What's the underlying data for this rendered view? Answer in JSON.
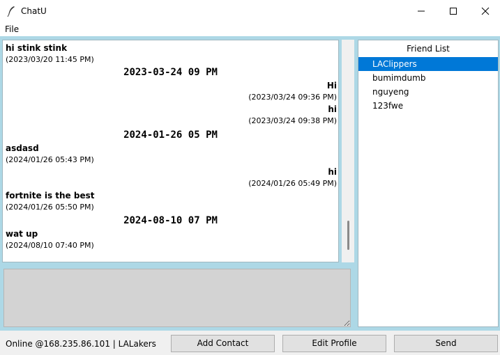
{
  "window": {
    "title": "ChatU",
    "app_icon": "feather-icon",
    "controls": [
      "minimize-icon",
      "maximize-icon",
      "close-icon"
    ]
  },
  "menu": {
    "items": [
      "File"
    ]
  },
  "chat": {
    "messages": [
      {
        "kind": "msg",
        "align": "left",
        "text": "hi stink stink"
      },
      {
        "kind": "ts",
        "align": "left",
        "text": "(2023/03/20 11:45 PM)"
      },
      {
        "kind": "date",
        "align": "center",
        "text": "2023-03-24 09 PM"
      },
      {
        "kind": "msg",
        "align": "right",
        "text": "Hi"
      },
      {
        "kind": "ts",
        "align": "right",
        "text": "(2023/03/24 09:36 PM)"
      },
      {
        "kind": "msg",
        "align": "right",
        "text": "hi"
      },
      {
        "kind": "ts",
        "align": "right",
        "text": "(2023/03/24 09:38 PM)"
      },
      {
        "kind": "date",
        "align": "center",
        "text": "2024-01-26 05 PM"
      },
      {
        "kind": "msg",
        "align": "left",
        "text": "asdasd"
      },
      {
        "kind": "ts",
        "align": "left",
        "text": "(2024/01/26 05:43 PM)"
      },
      {
        "kind": "msg",
        "align": "right",
        "text": "hi"
      },
      {
        "kind": "ts",
        "align": "right",
        "text": "(2024/01/26 05:49 PM)"
      },
      {
        "kind": "msg",
        "align": "left",
        "text": "fortnite is the best"
      },
      {
        "kind": "ts",
        "align": "left",
        "text": "(2024/01/26 05:50 PM)"
      },
      {
        "kind": "date",
        "align": "center",
        "text": "2024-08-10 07 PM"
      },
      {
        "kind": "msg",
        "align": "left",
        "text": "wat up"
      },
      {
        "kind": "ts",
        "align": "left",
        "text": "(2024/08/10 07:40 PM)"
      }
    ],
    "input_value": ""
  },
  "friends": {
    "header": "Friend List",
    "items": [
      "LAClippers",
      "bumimdumb",
      "nguyeng",
      "123fwe"
    ],
    "selected": "LAClippers"
  },
  "status": {
    "text": "Online @168.235.86.101 | LALakers"
  },
  "buttons": {
    "add_contact": "Add Contact",
    "edit_profile": "Edit Profile",
    "send": "Send"
  },
  "colors": {
    "frame": "#add8e6",
    "selection": "#0078d7",
    "input_bg": "#d3d3d3"
  }
}
